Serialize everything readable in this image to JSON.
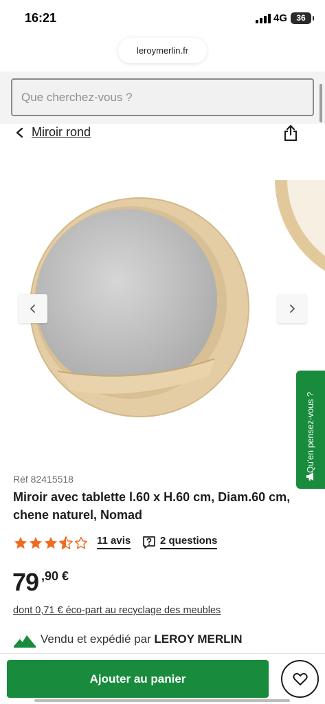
{
  "status_bar": {
    "time": "16:21",
    "network": "4G",
    "battery": "36"
  },
  "browser": {
    "url": "leroymerlin.fr"
  },
  "search": {
    "placeholder": "Que cherchez-vous ?"
  },
  "breadcrumb": {
    "label": "Miroir rond",
    "back_icon": "chevron-left-icon",
    "share_icon": "share-icon"
  },
  "gallery": {
    "prev_icon": "chevron-left-icon",
    "next_icon": "chevron-right-icon"
  },
  "feedback_tab": {
    "label": "Qu'en pensez-vous ?",
    "icon": "megaphone-icon"
  },
  "product": {
    "ref": "Réf 82415518",
    "title": "Miroir avec tablette l.60 x H.60 cm, Diam.60 cm, chene naturel, Nomad",
    "rating": 3.5,
    "rating_max": 5,
    "reviews": "11 avis",
    "questions": "2 questions",
    "price_int": "79",
    "price_dec": ",90 €",
    "eco_part": "dont 0,71 € éco-part au recyclage des meubles",
    "vendor_prefix": "Vendu et expédié par",
    "vendor_name": "LEROY MERLIN"
  },
  "actions": {
    "add_to_cart": "Ajouter au panier",
    "favorite_icon": "heart-icon"
  },
  "colors": {
    "brand_green": "#188c3c",
    "star_orange": "#ef6c1f",
    "wood": "#e6cfa6"
  }
}
